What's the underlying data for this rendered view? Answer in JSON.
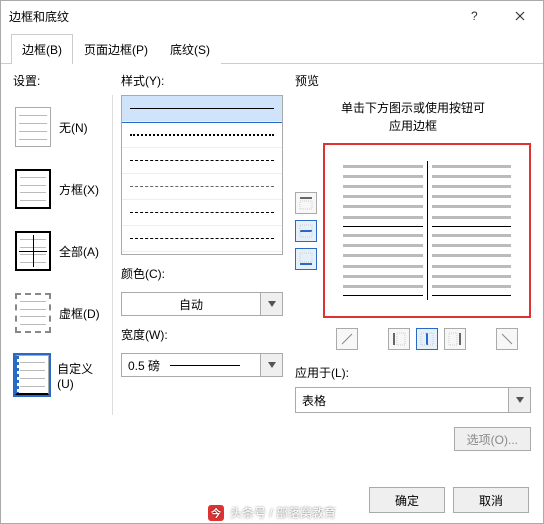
{
  "window": {
    "title": "边框和底纹"
  },
  "tabs": [
    {
      "label": "边框(B)",
      "active": true
    },
    {
      "label": "页面边框(P)",
      "active": false
    },
    {
      "label": "底纹(S)",
      "active": false
    }
  ],
  "settings": {
    "label": "设置:",
    "items": [
      {
        "label": "无(N)"
      },
      {
        "label": "方框(X)"
      },
      {
        "label": "全部(A)"
      },
      {
        "label": "虚框(D)"
      },
      {
        "label": "自定义(U)"
      }
    ],
    "selected": 4
  },
  "style": {
    "label": "样式(Y):"
  },
  "color": {
    "label": "颜色(C):",
    "value": "自动"
  },
  "width": {
    "label": "宽度(W):",
    "value": "0.5 磅"
  },
  "preview": {
    "label": "预览",
    "hint_line1": "单击下方图示或使用按钮可",
    "hint_line2": "应用边框"
  },
  "apply": {
    "label": "应用于(L):",
    "value": "表格"
  },
  "options_btn": "选项(O)...",
  "buttons": {
    "ok": "确定",
    "cancel": "取消"
  },
  "watermark": "头条号 / 部落窝教育"
}
